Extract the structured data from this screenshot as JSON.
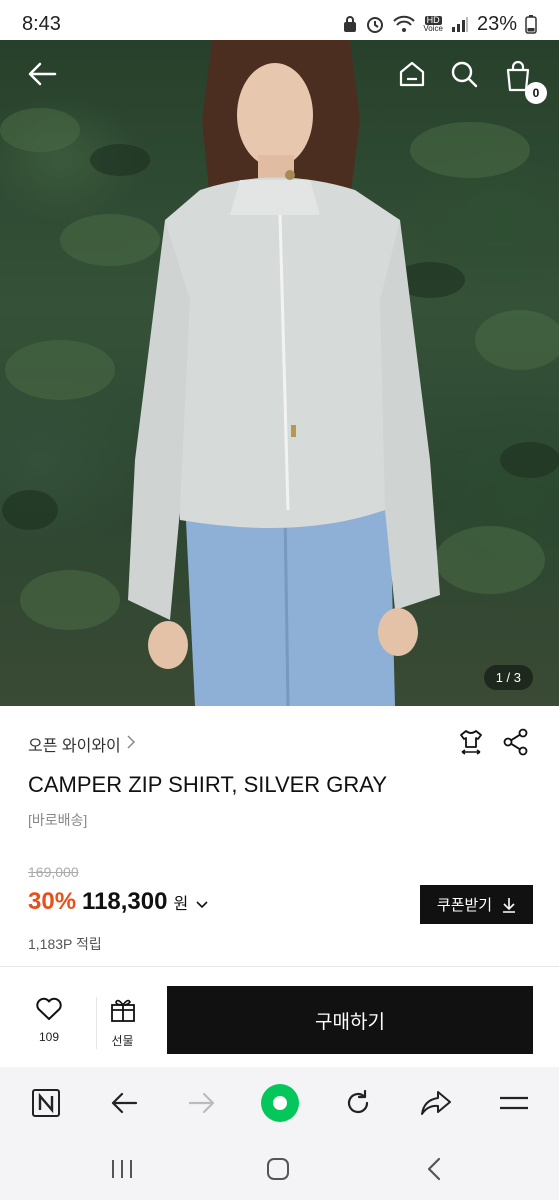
{
  "status_bar": {
    "time": "8:43",
    "battery": "23%",
    "hd_label": "HD",
    "voice_label": "Voice"
  },
  "header": {
    "cart_count": "0"
  },
  "hero": {
    "page_indicator": "1 / 3"
  },
  "product": {
    "brand": "오픈 와이와이",
    "title": "CAMPER ZIP SHIRT, SILVER GRAY",
    "shipping": "[바로배송]",
    "original_price": "169,000",
    "discount": "30%",
    "price": "118,300",
    "currency": "원",
    "coupon_label": "쿠폰받기",
    "points": "1,183P 적립"
  },
  "actions": {
    "like_count": "109",
    "gift_label": "선물",
    "buy_label": "구매하기"
  },
  "colors": {
    "discount": "#e8501b",
    "button_dark": "#111111",
    "browser_green": "#03c75a"
  },
  "icons": [
    "back-arrow-icon",
    "home-icon",
    "search-icon",
    "cart-icon",
    "size-guide-icon",
    "share-icon",
    "heart-icon",
    "gift-icon",
    "download-icon",
    "naver-n-icon",
    "refresh-icon",
    "recents-icon"
  ]
}
